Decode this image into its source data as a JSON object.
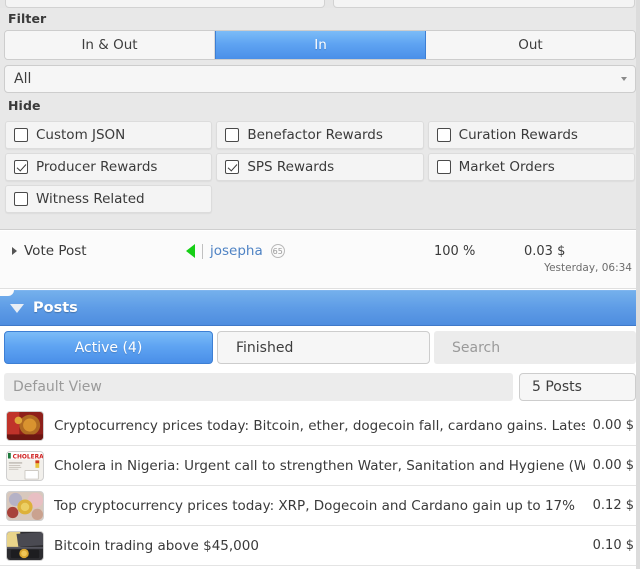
{
  "filter": {
    "section_label": "Filter",
    "segments": [
      {
        "label": "In & Out",
        "active": false
      },
      {
        "label": "In",
        "active": true
      },
      {
        "label": "Out",
        "active": false
      }
    ],
    "type_dropdown": {
      "value": "All",
      "icon": "chevron-down-icon"
    }
  },
  "hide": {
    "section_label": "Hide",
    "options": [
      {
        "label": "Custom JSON",
        "checked": false
      },
      {
        "label": "Benefactor Rewards",
        "checked": false
      },
      {
        "label": "Curation Rewards",
        "checked": false
      },
      {
        "label": "Producer Rewards",
        "checked": true
      },
      {
        "label": "SPS Rewards",
        "checked": true
      },
      {
        "label": "Market Orders",
        "checked": false
      },
      {
        "label": "Witness Related",
        "checked": false
      }
    ]
  },
  "vote_row": {
    "expand_icon": "chevron-right-icon",
    "title": "Vote Post",
    "vote_direction_icon": "triangle-left-icon",
    "username": "josepha",
    "reputation": "65",
    "percent": "100 %",
    "amount": "0.03 $",
    "timestamp": "Yesterday, 06:34",
    "accent_green": "#16cf16",
    "link_blue": "#4f83c4"
  },
  "posts_header": {
    "collapse_icon": "triangle-down-icon",
    "title": "Posts",
    "accent_blue": "#5e9ce6"
  },
  "posts_toolbar": {
    "tabs": [
      {
        "label": "Active (4)",
        "active": true
      },
      {
        "label": "Finished",
        "active": false
      }
    ],
    "search": {
      "placeholder": "Search",
      "value": ""
    },
    "view_select": {
      "value": "Default View",
      "icon": "chevron-down-icon"
    },
    "count_select": {
      "value": "5 Posts",
      "icon": "chevron-down-icon"
    }
  },
  "posts": [
    {
      "title": "Cryptocurrency prices today: Bitcoin, ether, dogecoin fall, cardano gains. Lates",
      "amount": "0.00 $",
      "thumb": "bitcoin-red-coins"
    },
    {
      "title": "Cholera in Nigeria: Urgent call to strengthen Water, Sanitation and Hygiene (W",
      "amount": "0.00 $",
      "thumb": "cholera-document"
    },
    {
      "title": "Top cryptocurrency prices today: XRP, Dogecoin and Cardano gain up to 17%",
      "amount": "0.12 $",
      "thumb": "colorful-coins"
    },
    {
      "title": "Bitcoin trading above $45,000",
      "amount": "0.10 $",
      "thumb": "bitcoin-laptop"
    }
  ]
}
